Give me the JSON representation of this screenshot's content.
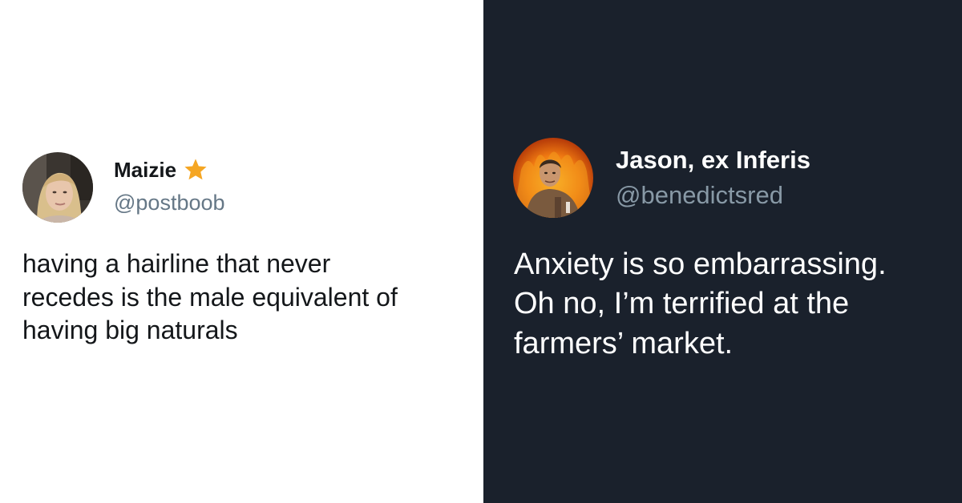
{
  "left_tweet": {
    "name": "Maizie",
    "verified_icon": "star-icon",
    "handle": "@postboob",
    "text_lines": [
      "having a hairline that never",
      "recedes is the male equivalent of",
      "having big naturals"
    ]
  },
  "right_tweet": {
    "name": "Jason, ex Inferis",
    "handle": "@benedictsred",
    "text_lines": [
      "Anxiety is so embarrassing.",
      "Oh no, I’m terrified at the",
      "farmers’ market."
    ]
  },
  "colors": {
    "left_background": "#ffffff",
    "right_background": "#1a212c",
    "star": "#f5a623"
  }
}
